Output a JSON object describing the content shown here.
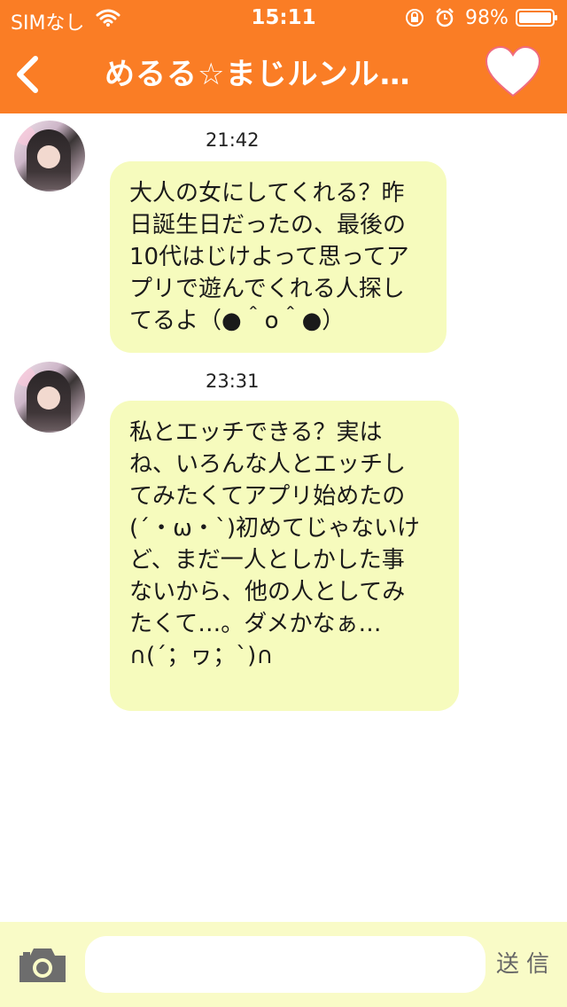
{
  "status_bar": {
    "carrier": "SIMなし",
    "time": "15:11",
    "battery": "98%"
  },
  "header": {
    "back_icon": "chevron-left-icon",
    "title": "めるる☆まじルンル…",
    "favorite_icon": "heart-icon"
  },
  "messages": [
    {
      "time": "21:42",
      "text": "大人の女にしてくれる？昨\n日誕生日だったの、最後の\n10代はじけよって思ってア\nプリで遊んでくれる人探し\nてるよ（●＾o＾●）"
    },
    {
      "time": "23:31",
      "text": "私とエッチできる？実は\nね、いろんな人とエッチし\nてみたくてアプリ始めたの\n(´・ω・`)初めてじゃないけ\nど、まだ一人としかした事\nないから、他の人としてみ\nたくて…。ダメかなぁ…\n∩(´；ヮ；`)∩"
    }
  ],
  "composer": {
    "camera_icon": "camera-icon",
    "input_value": "",
    "send_label": "送信"
  },
  "colors": {
    "accent": "#fa7d25",
    "bubble": "#f6fbbd",
    "input_bar": "#f9fbc7"
  }
}
